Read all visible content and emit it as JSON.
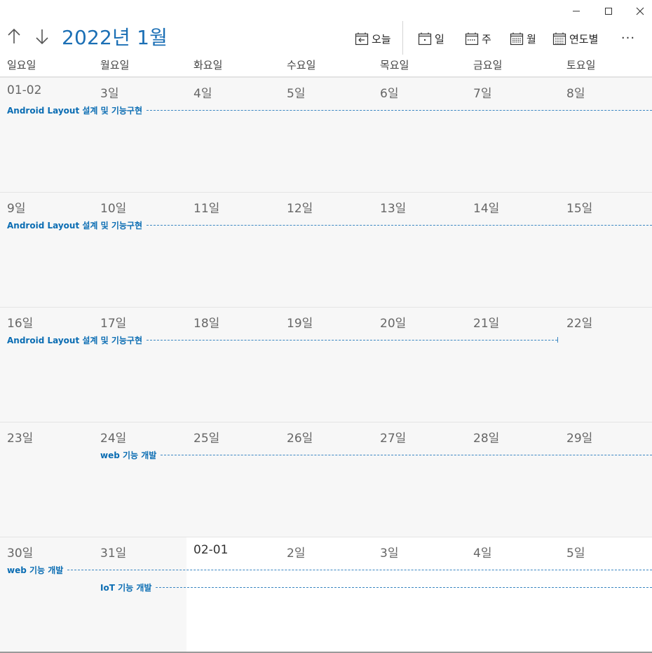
{
  "window": {
    "minimize": "─",
    "maximize": "☐",
    "close": "✕"
  },
  "nav": {
    "up_icon": "up-arrow-icon",
    "down_icon": "down-arrow-icon"
  },
  "title": "2022년 1월",
  "toolbar": {
    "today": "오늘",
    "day": "일",
    "week": "주",
    "month": "월",
    "year": "연도별",
    "more": "···"
  },
  "weekdays": [
    "일요일",
    "월요일",
    "화요일",
    "수요일",
    "목요일",
    "금요일",
    "토요일"
  ],
  "weeks": [
    {
      "days": [
        "01-02",
        "3일",
        "4일",
        "5일",
        "6일",
        "7일",
        "8일"
      ]
    },
    {
      "days": [
        "9일",
        "10일",
        "11일",
        "12일",
        "13일",
        "14일",
        "15일"
      ]
    },
    {
      "days": [
        "16일",
        "17일",
        "18일",
        "19일",
        "20일",
        "21일",
        "22일"
      ]
    },
    {
      "days": [
        "23일",
        "24일",
        "25일",
        "26일",
        "27일",
        "28일",
        "29일"
      ]
    },
    {
      "days": [
        "30일",
        "31일",
        "02-01",
        "2일",
        "3일",
        "4일",
        "5일"
      ]
    }
  ],
  "events": [
    {
      "label": "Android Layout 설계 및 기능구현"
    },
    {
      "label": "Android Layout 설계 및 기능구현"
    },
    {
      "label": "Android Layout 설계 및 기능구현"
    },
    {
      "label": "web 기능 개발"
    },
    {
      "label": "web 기능 개발"
    },
    {
      "label": "IoT 기능 개발"
    }
  ],
  "colors": {
    "accent": "#1b6fb5",
    "event": "#0b6db3",
    "current_month_bg": "#f7f7f7",
    "next_month_bg": "#ffffff"
  }
}
